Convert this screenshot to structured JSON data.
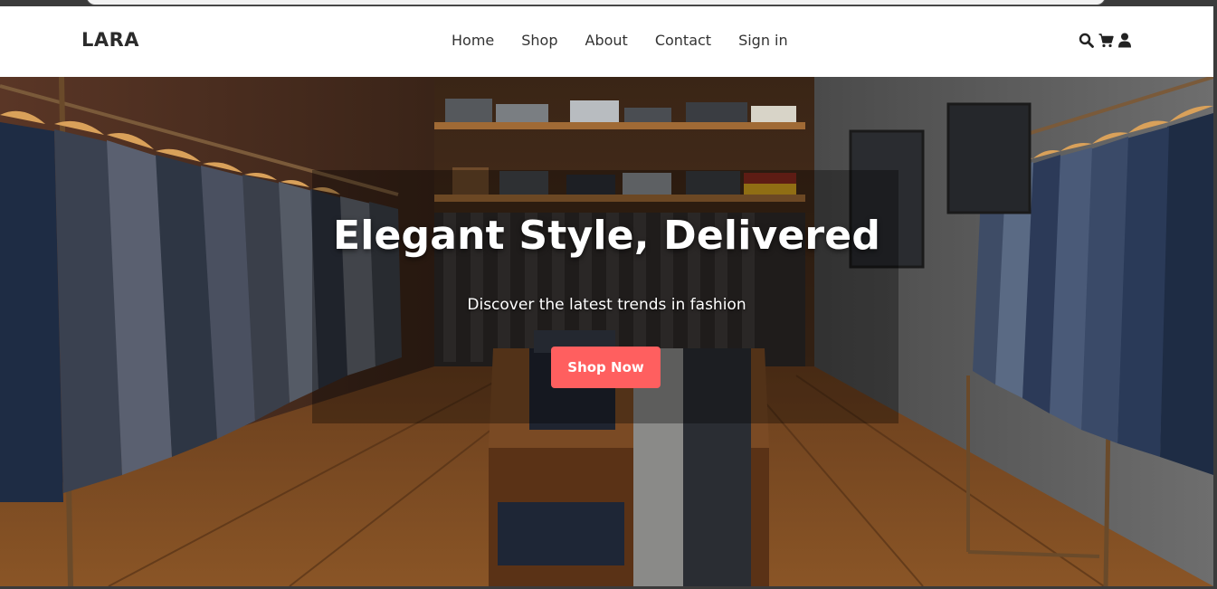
{
  "brand": {
    "logo": "LARA"
  },
  "nav": {
    "links": [
      "Home",
      "Shop",
      "About",
      "Contact",
      "Sign in"
    ]
  },
  "icons": [
    "search-icon",
    "cart-icon",
    "user-icon"
  ],
  "hero": {
    "title": "Elegant Style, Delivered",
    "subtitle": "Discover the latest trends in fashion",
    "cta_label": "Shop Now"
  },
  "colors": {
    "accent": "#ff5f5f",
    "nav_text": "#333333",
    "logo_text": "#2b2b2b"
  }
}
